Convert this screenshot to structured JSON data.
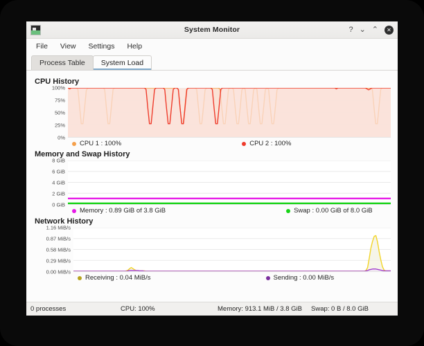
{
  "window": {
    "title": "System Monitor",
    "icon_name": "system-monitor-icon",
    "controls": {
      "help": "?",
      "minimize": "⌄",
      "maximize": "⌃",
      "close": "✕"
    }
  },
  "menubar": {
    "items": [
      {
        "label": "File"
      },
      {
        "label": "View"
      },
      {
        "label": "Settings"
      },
      {
        "label": "Help"
      }
    ]
  },
  "tabs": [
    {
      "label": "Process Table",
      "active": false
    },
    {
      "label": "System Load",
      "active": true
    }
  ],
  "sections": {
    "cpu": {
      "title": "CPU History",
      "legend": [
        {
          "label": "CPU 1 : 100%",
          "color": "#f5a04b"
        },
        {
          "label": "CPU 2 : 100%",
          "color": "#ef3b2c"
        }
      ]
    },
    "memory": {
      "title": "Memory and Swap History",
      "legend": [
        {
          "label": "Memory : 0.89 GiB of 3.8 GiB",
          "color": "#e619e6"
        },
        {
          "label": "Swap : 0.00 GiB of 8.0 GiB",
          "color": "#17d417"
        }
      ]
    },
    "network": {
      "title": "Network History",
      "legend": [
        {
          "label": "Receiving : 0.04 MiB/s",
          "color": "#b8a31e"
        },
        {
          "label": "Sending : 0.00 MiB/s",
          "color": "#7b2f9e"
        }
      ]
    }
  },
  "statusbar": {
    "processes": "0 processes",
    "cpu": "CPU: 100%",
    "memory": "Memory: 913.1 MiB / 3.8 GiB",
    "swap": "Swap: 0 B / 8.0 GiB"
  },
  "chart_data": [
    {
      "id": "cpu",
      "type": "line",
      "title": "CPU History",
      "xlabel": "",
      "ylabel": "",
      "ylim": [
        0,
        100
      ],
      "yticks": [
        100,
        75,
        50,
        25,
        0
      ],
      "ytick_labels": [
        "100%",
        "75%",
        "50%",
        "25%",
        "0%"
      ],
      "grid": true,
      "legend_position": "bottom",
      "series": [
        {
          "name": "CPU 1",
          "color": "#f5a04b",
          "fill": "#fae0d2",
          "values": [
            100,
            100,
            100,
            100,
            100,
            100,
            97,
            62,
            27,
            27,
            60,
            95,
            100,
            100,
            100,
            100,
            100,
            100,
            100,
            100,
            100,
            100,
            97,
            60,
            27,
            27,
            62,
            97,
            100,
            100,
            100,
            100,
            100,
            100,
            100,
            100,
            100,
            100,
            100,
            100,
            100,
            100,
            100,
            100,
            100,
            100,
            100,
            100,
            100,
            100,
            100,
            100,
            100,
            100,
            100,
            100,
            100,
            100,
            100,
            100,
            100,
            100,
            100,
            100,
            100,
            100,
            97,
            60,
            27,
            27,
            62,
            97,
            100,
            100,
            100,
            100,
            100,
            97,
            62,
            27,
            27,
            60,
            96,
            100,
            100,
            100,
            100,
            100,
            100,
            100,
            100,
            97,
            60,
            27,
            27,
            62,
            97,
            100,
            100,
            97,
            60,
            27,
            27,
            60,
            96,
            100,
            97,
            60,
            27,
            27,
            60,
            96,
            100,
            97,
            60,
            27,
            27,
            60,
            96,
            100,
            97,
            60,
            27,
            27,
            60,
            96,
            100,
            100,
            100,
            100,
            100,
            100,
            100,
            100,
            100,
            100,
            100,
            100,
            100,
            100,
            100,
            100,
            100,
            100,
            100,
            100,
            100,
            100,
            100,
            100,
            100,
            100,
            100,
            100,
            100,
            100,
            100,
            100,
            100,
            100,
            100,
            100,
            100,
            100,
            100,
            100,
            100,
            100,
            100,
            100,
            100,
            100,
            100,
            100,
            100,
            100,
            100,
            100,
            100,
            100,
            100,
            100,
            97,
            60,
            27,
            27,
            62,
            97,
            100,
            100,
            100,
            100,
            100,
            100
          ]
        },
        {
          "name": "CPU 2",
          "color": "#ef3b2c",
          "fill": "#fbe3dc",
          "values": [
            100,
            98,
            100,
            100,
            100,
            100,
            100,
            100,
            100,
            100,
            100,
            100,
            100,
            100,
            100,
            100,
            100,
            100,
            100,
            100,
            100,
            100,
            100,
            100,
            100,
            100,
            100,
            100,
            100,
            100,
            100,
            100,
            100,
            100,
            100,
            100,
            100,
            100,
            100,
            100,
            100,
            100,
            100,
            100,
            100,
            100,
            97,
            60,
            27,
            27,
            62,
            97,
            100,
            100,
            100,
            100,
            100,
            97,
            60,
            27,
            27,
            62,
            97,
            100,
            100,
            97,
            60,
            27,
            27,
            62,
            97,
            100,
            100,
            100,
            100,
            100,
            100,
            100,
            100,
            100,
            100,
            100,
            100,
            100,
            100,
            97,
            60,
            27,
            27,
            62,
            97,
            100,
            100,
            100,
            100,
            100,
            100,
            100,
            100,
            100,
            100,
            100,
            100,
            100,
            100,
            100,
            100,
            100,
            100,
            100,
            100,
            100,
            100,
            100,
            100,
            100,
            100,
            100,
            100,
            100,
            100,
            100,
            100,
            100,
            100,
            100,
            100,
            100,
            100,
            100,
            100,
            100,
            100,
            100,
            100,
            100,
            100,
            100,
            100,
            100,
            100,
            100,
            100,
            100,
            100,
            100,
            100,
            100,
            100,
            100,
            100,
            100,
            100,
            100,
            100,
            100,
            100,
            100,
            98,
            100,
            100,
            100,
            100,
            100,
            100,
            100,
            100,
            100,
            100,
            100,
            100,
            100,
            100,
            100,
            100,
            100,
            98,
            96,
            98,
            100,
            100,
            100,
            100,
            100,
            100,
            100,
            100,
            100,
            100,
            100,
            100
          ]
        }
      ]
    },
    {
      "id": "memory",
      "type": "line",
      "title": "Memory and Swap History",
      "xlabel": "",
      "ylabel": "",
      "ylim": [
        0,
        8
      ],
      "yticks": [
        8,
        6,
        4,
        2,
        0
      ],
      "ytick_labels": [
        "8 GiB",
        "6 GiB",
        "4 GiB",
        "2 GiB",
        "0 GiB"
      ],
      "grid": true,
      "legend_position": "bottom",
      "series": [
        {
          "name": "Memory",
          "color": "#e619e6",
          "constant_value": 0.89
        },
        {
          "name": "Swap",
          "color": "#17d417",
          "constant_value": 0.0
        }
      ]
    },
    {
      "id": "network",
      "type": "line",
      "title": "Network History",
      "xlabel": "",
      "ylabel": "",
      "ylim": [
        0,
        1.16
      ],
      "yticks": [
        1.16,
        0.87,
        0.58,
        0.29,
        0.0
      ],
      "ytick_labels": [
        "1.16 MiB/s",
        "0.87 MiB/s",
        "0.58 MiB/s",
        "0.29 MiB/s",
        "0.00 MiB/s"
      ],
      "grid": true,
      "legend_position": "bottom",
      "series": [
        {
          "name": "Receiving",
          "color": "#f2d426",
          "fill": "#f3f1e2",
          "values": [
            0,
            0,
            0,
            0,
            0,
            0,
            0,
            0,
            0,
            0,
            0,
            0,
            0,
            0,
            0,
            0,
            0,
            0,
            0,
            0,
            0,
            0,
            0,
            0,
            0,
            0,
            0,
            0,
            0,
            0,
            0,
            0,
            0.01,
            0.03,
            0.07,
            0.1,
            0.07,
            0.04,
            0.02,
            0.01,
            0.01,
            0.01,
            0.01,
            0.01,
            0,
            0,
            0,
            0,
            0,
            0,
            0,
            0,
            0,
            0,
            0,
            0,
            0,
            0,
            0,
            0,
            0,
            0,
            0,
            0,
            0,
            0,
            0,
            0,
            0,
            0,
            0,
            0,
            0,
            0,
            0,
            0,
            0,
            0,
            0,
            0,
            0,
            0,
            0,
            0,
            0,
            0,
            0,
            0,
            0,
            0,
            0,
            0,
            0,
            0,
            0,
            0,
            0,
            0,
            0,
            0,
            0,
            0,
            0,
            0,
            0,
            0,
            0,
            0,
            0,
            0,
            0,
            0,
            0,
            0,
            0,
            0,
            0,
            0,
            0,
            0,
            0,
            0,
            0,
            0,
            0,
            0,
            0,
            0,
            0,
            0,
            0,
            0,
            0,
            0,
            0,
            0,
            0,
            0,
            0,
            0,
            0,
            0,
            0,
            0,
            0,
            0,
            0,
            0,
            0,
            0,
            0,
            0,
            0,
            0,
            0,
            0,
            0,
            0,
            0,
            0,
            0,
            0,
            0,
            0,
            0,
            0,
            0,
            0,
            0,
            0,
            0,
            0,
            0,
            0,
            0,
            0,
            0,
            0.02,
            0.1,
            0.35,
            0.62,
            0.8,
            0.93,
            0.95,
            0.78,
            0.52,
            0.3,
            0.12,
            0.03,
            0.01,
            0.01,
            0.01,
            0.01
          ]
        },
        {
          "name": "Sending",
          "color": "#a23fcd",
          "fill": "#efe2f5",
          "values": [
            0,
            0,
            0,
            0,
            0,
            0,
            0,
            0,
            0,
            0,
            0,
            0,
            0,
            0,
            0,
            0,
            0,
            0,
            0,
            0,
            0,
            0,
            0,
            0,
            0,
            0,
            0,
            0,
            0,
            0,
            0,
            0,
            0,
            0.01,
            0.02,
            0.02,
            0.02,
            0.02,
            0.02,
            0.02,
            0.01,
            0.01,
            0.01,
            0,
            0,
            0,
            0,
            0,
            0,
            0,
            0,
            0,
            0,
            0,
            0,
            0,
            0,
            0,
            0,
            0,
            0,
            0,
            0,
            0,
            0,
            0,
            0,
            0,
            0,
            0,
            0,
            0,
            0,
            0,
            0,
            0,
            0,
            0,
            0,
            0,
            0,
            0,
            0,
            0,
            0,
            0,
            0,
            0,
            0,
            0,
            0,
            0,
            0,
            0,
            0,
            0,
            0,
            0,
            0,
            0,
            0,
            0,
            0,
            0,
            0,
            0,
            0,
            0,
            0,
            0,
            0,
            0,
            0,
            0,
            0,
            0,
            0,
            0,
            0,
            0,
            0,
            0,
            0,
            0,
            0,
            0,
            0,
            0,
            0,
            0,
            0,
            0,
            0,
            0,
            0,
            0,
            0,
            0,
            0,
            0,
            0,
            0,
            0,
            0,
            0,
            0,
            0,
            0,
            0,
            0,
            0,
            0,
            0,
            0,
            0,
            0,
            0,
            0,
            0,
            0,
            0,
            0,
            0,
            0,
            0,
            0,
            0,
            0,
            0,
            0,
            0,
            0,
            0,
            0,
            0,
            0,
            0,
            0.01,
            0.02,
            0.04,
            0.05,
            0.06,
            0.06,
            0.06,
            0.05,
            0.04,
            0.03,
            0.02,
            0.01,
            0.01,
            0.01,
            0.01,
            0.01
          ]
        }
      ]
    }
  ]
}
